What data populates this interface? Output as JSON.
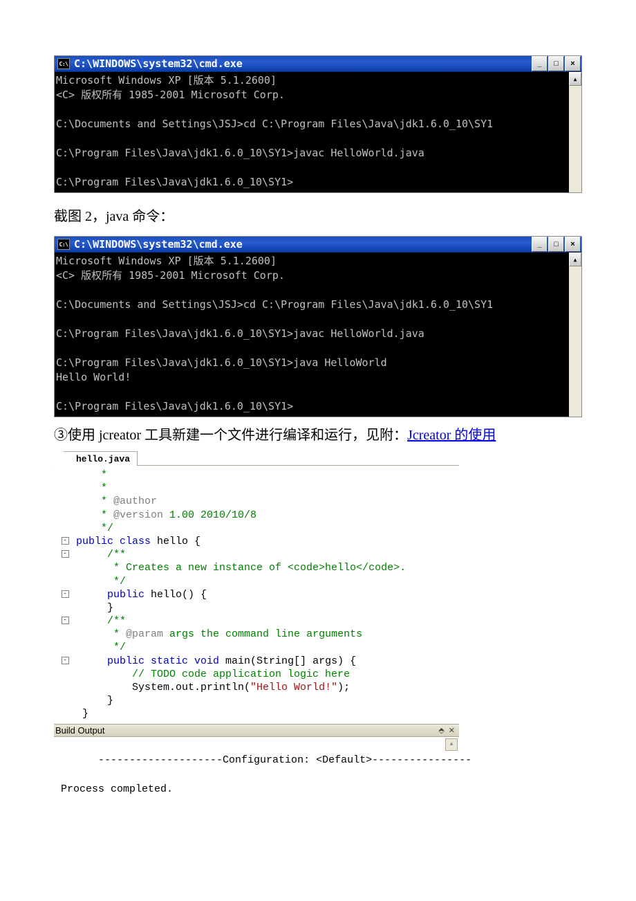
{
  "cmd1": {
    "icon_text": "C:\\",
    "title": "C:\\WINDOWS\\system32\\cmd.exe",
    "buttons": {
      "min": "_",
      "max": "□",
      "close": "×"
    },
    "scroll_up": "▲",
    "lines": "Microsoft Windows XP [版本 5.1.2600]\n<C> 版权所有 1985-2001 Microsoft Corp.\n\nC:\\Documents and Settings\\JSJ>cd C:\\Program Files\\Java\\jdk1.6.0_10\\SY1\n\nC:\\Program Files\\Java\\jdk1.6.0_10\\SY1>javac HelloWorld.java\n\nC:\\Program Files\\Java\\jdk1.6.0_10\\SY1>\n"
  },
  "caption2": "截图 2，java 命令：",
  "cmd2": {
    "icon_text": "C:\\",
    "title": "C:\\WINDOWS\\system32\\cmd.exe",
    "buttons": {
      "min": "_",
      "max": "□",
      "close": "×"
    },
    "scroll_up": "▲",
    "lines": "Microsoft Windows XP [版本 5.1.2600]\n<C> 版权所有 1985-2001 Microsoft Corp.\n\nC:\\Documents and Settings\\JSJ>cd C:\\Program Files\\Java\\jdk1.6.0_10\\SY1\n\nC:\\Program Files\\Java\\jdk1.6.0_10\\SY1>javac HelloWorld.java\n\nC:\\Program Files\\Java\\jdk1.6.0_10\\SY1>java HelloWorld\nHello World!\n\nC:\\Program Files\\Java\\jdk1.6.0_10\\SY1>"
  },
  "instr3_prefix": "③使用 jcreator 工具新建一个文件进行编译和运行，见附：",
  "instr3_link": "Jcreator 的使用",
  "editor": {
    "tab": "hello.java",
    "folds": {
      "l6": "-",
      "l8": "-",
      "l11": "-",
      "l14": "-",
      "l17": "-"
    },
    "code": {
      "l1": "    *",
      "l2": "    *",
      "l3a": "    * ",
      "l3b": "@author",
      "l4a": "    * ",
      "l4b": "@version",
      "l4c": " 1.00 2010/10/8",
      "l5": "    */",
      "l6a": "public class",
      "l6b": " hello {",
      "l8": "     /**",
      "l9": "      * Creates a new instance of <code>hello</code>.",
      "l10": "      */",
      "l11a": "     ",
      "l11b": "public",
      "l11c": " hello() {",
      "l12": "     }",
      "l14": "     /**",
      "l15a": "      * ",
      "l15b": "@param",
      "l15c": " args the command line arguments",
      "l16": "      */",
      "l17a": "     ",
      "l17b": "public static void",
      "l17c": " main(String[] args) {",
      "l18": "         // TODO code application logic here",
      "l19a": "         System.out.println(",
      "l19b": "\"Hello World!\"",
      "l19c": ");",
      "l20": "     }",
      "l21": " }"
    },
    "build_title": "Build Output",
    "build_pin": "⬘",
    "build_close": "✕",
    "build_body": "--------------------Configuration: <Default>----------------\n\nProcess completed.",
    "build_scroll_up": "▲"
  }
}
